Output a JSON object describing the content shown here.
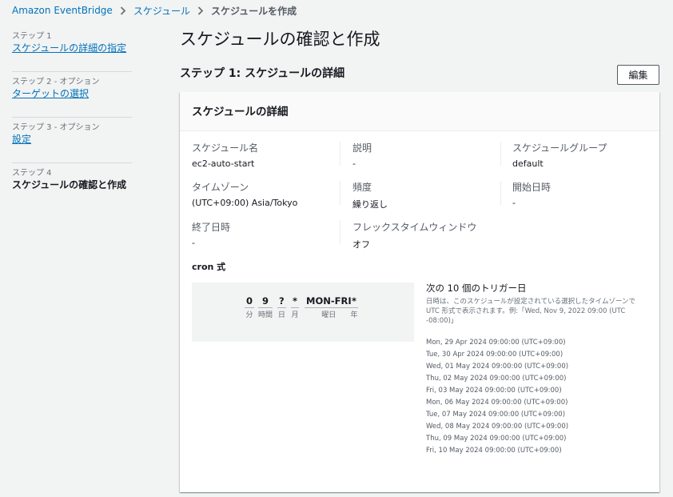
{
  "breadcrumb": {
    "items": [
      "Amazon EventBridge",
      "スケジュール"
    ],
    "current": "スケジュールを作成"
  },
  "steps": [
    {
      "label": "ステップ 1",
      "title": "スケジュールの詳細の指定",
      "state": "link"
    },
    {
      "label": "ステップ 2 - オプション",
      "title": "ターゲットの選択",
      "state": "link"
    },
    {
      "label": "ステップ 3 - オプション",
      "title": "設定",
      "state": "link"
    },
    {
      "label": "ステップ 4",
      "title": "スケジュールの確認と作成",
      "state": "current"
    }
  ],
  "page": {
    "title": "スケジュールの確認と作成",
    "section_title": "ステップ 1: スケジュールの詳細",
    "edit_label": "編集"
  },
  "panel": {
    "header": "スケジュールの詳細",
    "fields": {
      "schedule_name": {
        "label": "スケジュール名",
        "value": "ec2-auto-start"
      },
      "description": {
        "label": "説明",
        "value": "-"
      },
      "schedule_group": {
        "label": "スケジュールグループ",
        "value": "default"
      },
      "timezone": {
        "label": "タイムゾーン",
        "value": "(UTC+09:00) Asia/Tokyo"
      },
      "frequency": {
        "label": "頻度",
        "value": "繰り返し"
      },
      "start_date": {
        "label": "開始日時",
        "value": "-"
      },
      "end_date": {
        "label": "終了日時",
        "value": "-"
      },
      "flex_window": {
        "label": "フレックスタイムウィンドウ",
        "value": "オフ"
      }
    },
    "cron_label": "cron 式",
    "cron": [
      {
        "value": "0",
        "unit": "分"
      },
      {
        "value": "9",
        "unit": "時間"
      },
      {
        "value": "?",
        "unit": "日"
      },
      {
        "value": "*",
        "unit": "月"
      },
      {
        "value": "MON-FRI",
        "unit": "曜日"
      },
      {
        "value": "*",
        "unit": "年"
      }
    ],
    "triggers_title": "次の 10 個のトリガー日",
    "triggers_desc": "日時は、このスケジュールが設定されている選択したタイムゾーンで UTC 形式で表示されます。例:「Wed, Nov 9, 2022 09:00 (UTC -08:00)」",
    "triggers": [
      "Mon, 29 Apr 2024 09:00:00 (UTC+09:00)",
      "Tue, 30 Apr 2024 09:00:00 (UTC+09:00)",
      "Wed, 01 May 2024 09:00:00 (UTC+09:00)",
      "Thu, 02 May 2024 09:00:00 (UTC+09:00)",
      "Fri, 03 May 2024 09:00:00 (UTC+09:00)",
      "Mon, 06 May 2024 09:00:00 (UTC+09:00)",
      "Tue, 07 May 2024 09:00:00 (UTC+09:00)",
      "Wed, 08 May 2024 09:00:00 (UTC+09:00)",
      "Thu, 09 May 2024 09:00:00 (UTC+09:00)",
      "Fri, 10 May 2024 09:00:00 (UTC+09:00)"
    ]
  },
  "icons": {
    "breadcrumb_separator": "chevron-right-icon"
  },
  "colors": {
    "link": "#0073bb",
    "text": "#16191f",
    "background": "#f2f3f3"
  }
}
